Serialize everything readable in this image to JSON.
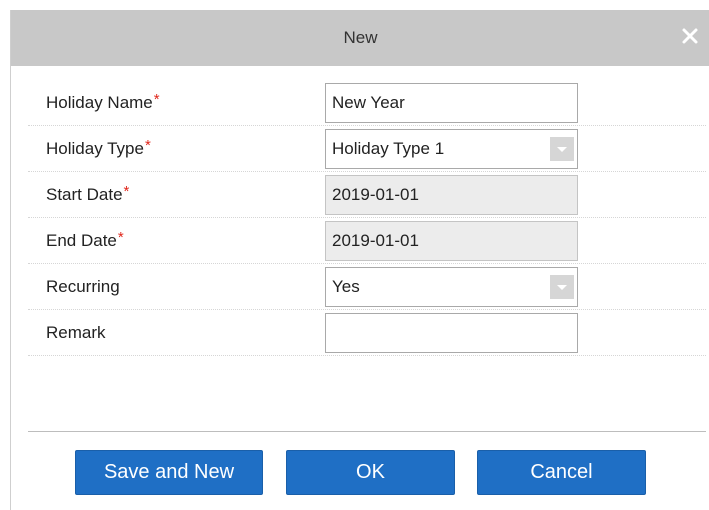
{
  "dialog": {
    "title": "New",
    "close_icon": "close-icon"
  },
  "form": {
    "required_mark": "*",
    "fields": [
      {
        "label": "Holiday Name",
        "required": true,
        "type": "text",
        "value": "New Year"
      },
      {
        "label": "Holiday Type",
        "required": true,
        "type": "select",
        "value": "Holiday Type 1",
        "icon": "chevron-down-icon"
      },
      {
        "label": "Start Date",
        "required": true,
        "type": "date",
        "value": "2019-01-01",
        "disabled": true
      },
      {
        "label": "End Date",
        "required": true,
        "type": "date",
        "value": "2019-01-01",
        "disabled": true
      },
      {
        "label": "Recurring",
        "required": false,
        "type": "select",
        "value": "Yes",
        "icon": "chevron-down-icon"
      },
      {
        "label": "Remark",
        "required": false,
        "type": "text",
        "value": ""
      }
    ]
  },
  "buttons": {
    "save_and_new": "Save and New",
    "ok": "OK",
    "cancel": "Cancel"
  },
  "colors": {
    "titlebar": "#c8c8c8",
    "button": "#1f6fc5",
    "required": "#e0261b",
    "disabled_field": "#ececec"
  }
}
